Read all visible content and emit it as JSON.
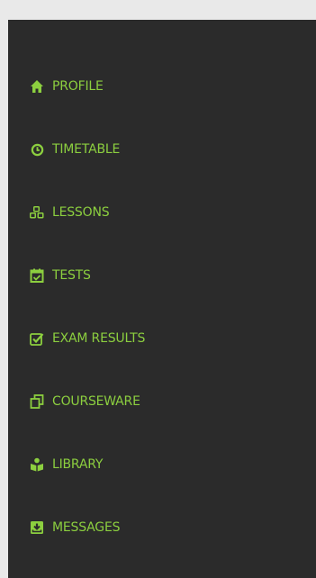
{
  "colors": {
    "sidebar_bg": "#2b2b2b",
    "accent": "#8ccf3f",
    "page_bg": "#e9e9e9"
  },
  "sidebar": {
    "items": [
      {
        "label": "PROFILE",
        "icon": "home-icon"
      },
      {
        "label": "TIMETABLE",
        "icon": "clock-icon"
      },
      {
        "label": "LESSONS",
        "icon": "cubes-icon"
      },
      {
        "label": "TESTS",
        "icon": "calendar-check-icon"
      },
      {
        "label": "EXAM RESULTS",
        "icon": "checkbox-icon"
      },
      {
        "label": "COURSEWARE",
        "icon": "copy-icon"
      },
      {
        "label": "LIBRARY",
        "icon": "book-reader-icon"
      },
      {
        "label": "MESSAGES",
        "icon": "inbox-icon"
      }
    ]
  }
}
